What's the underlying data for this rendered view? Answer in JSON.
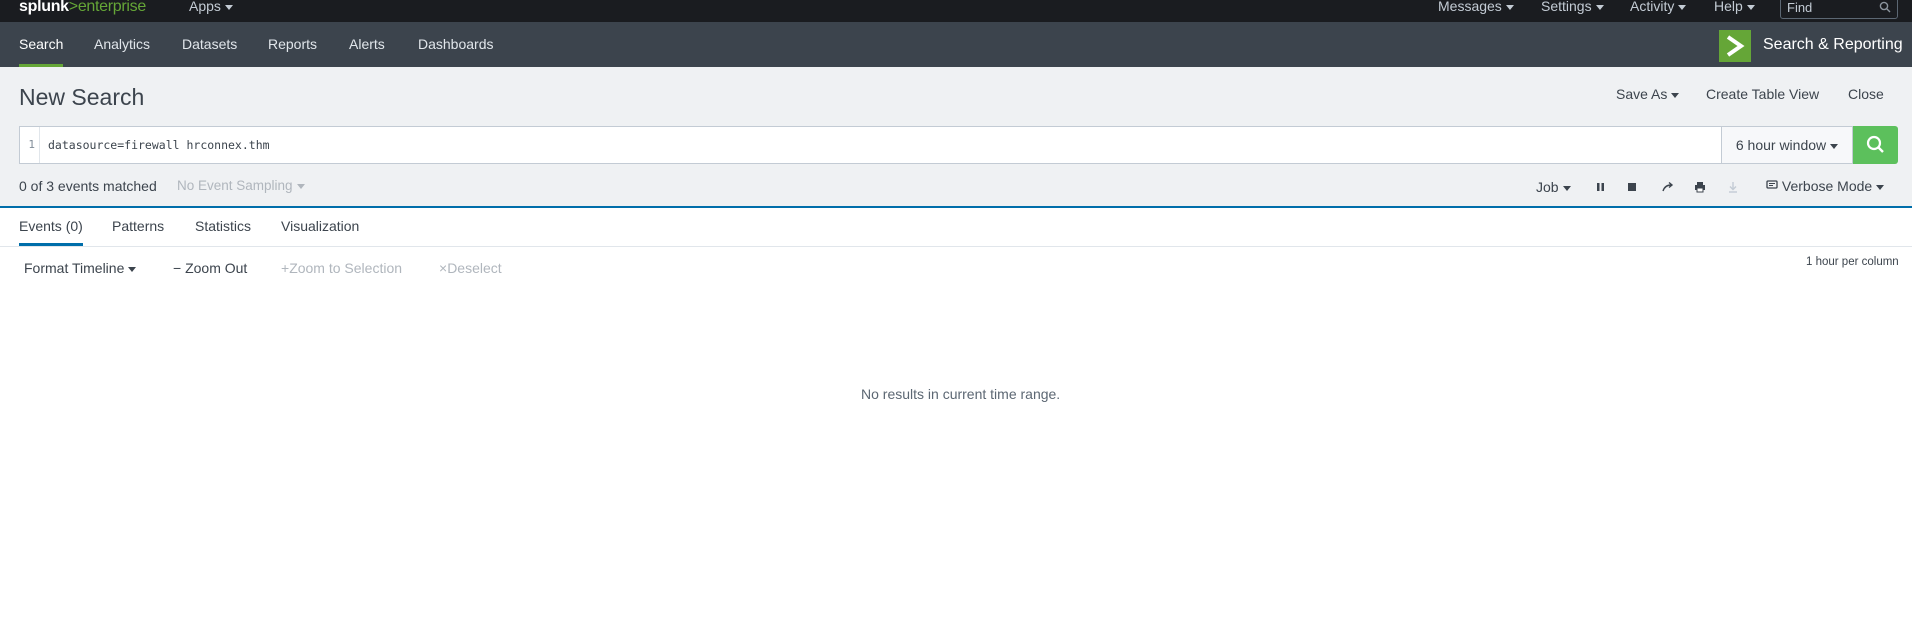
{
  "topbar": {
    "logo_prefix": "splunk",
    "logo_gt": ">",
    "logo_suffix": "enterprise",
    "apps_label": "Apps",
    "messages_label": "Messages",
    "settings_label": "Settings",
    "activity_label": "Activity",
    "help_label": "Help",
    "find_placeholder": "Find"
  },
  "appbar": {
    "nav": [
      "Search",
      "Analytics",
      "Datasets",
      "Reports",
      "Alerts",
      "Dashboards"
    ],
    "active_nav": "Search",
    "app_title": "Search & Reporting"
  },
  "header": {
    "title": "New Search",
    "save_as": "Save As",
    "create_table_view": "Create Table View",
    "close": "Close"
  },
  "search": {
    "line_number": "1",
    "query": "datasource=firewall hrconnex.thm",
    "time_range": "6 hour window"
  },
  "status": {
    "matched": "0 of 3 events matched",
    "sampling": "No Event Sampling",
    "job_label": "Job",
    "mode": "Verbose Mode"
  },
  "tabs": [
    "Events (0)",
    "Patterns",
    "Statistics",
    "Visualization"
  ],
  "timeline": {
    "format": "Format Timeline",
    "zoom_out": "Zoom Out",
    "zoom_selection": "Zoom to Selection",
    "deselect": "Deselect",
    "per_column": "1 hour per column"
  },
  "results": {
    "empty_message": "No results in current time range."
  },
  "colors": {
    "topbar_bg": "#1a1c20",
    "appbar_bg": "#3c444d",
    "accent_green": "#65a637",
    "search_button": "#5cc05c",
    "tab_blue": "#006eaa"
  }
}
